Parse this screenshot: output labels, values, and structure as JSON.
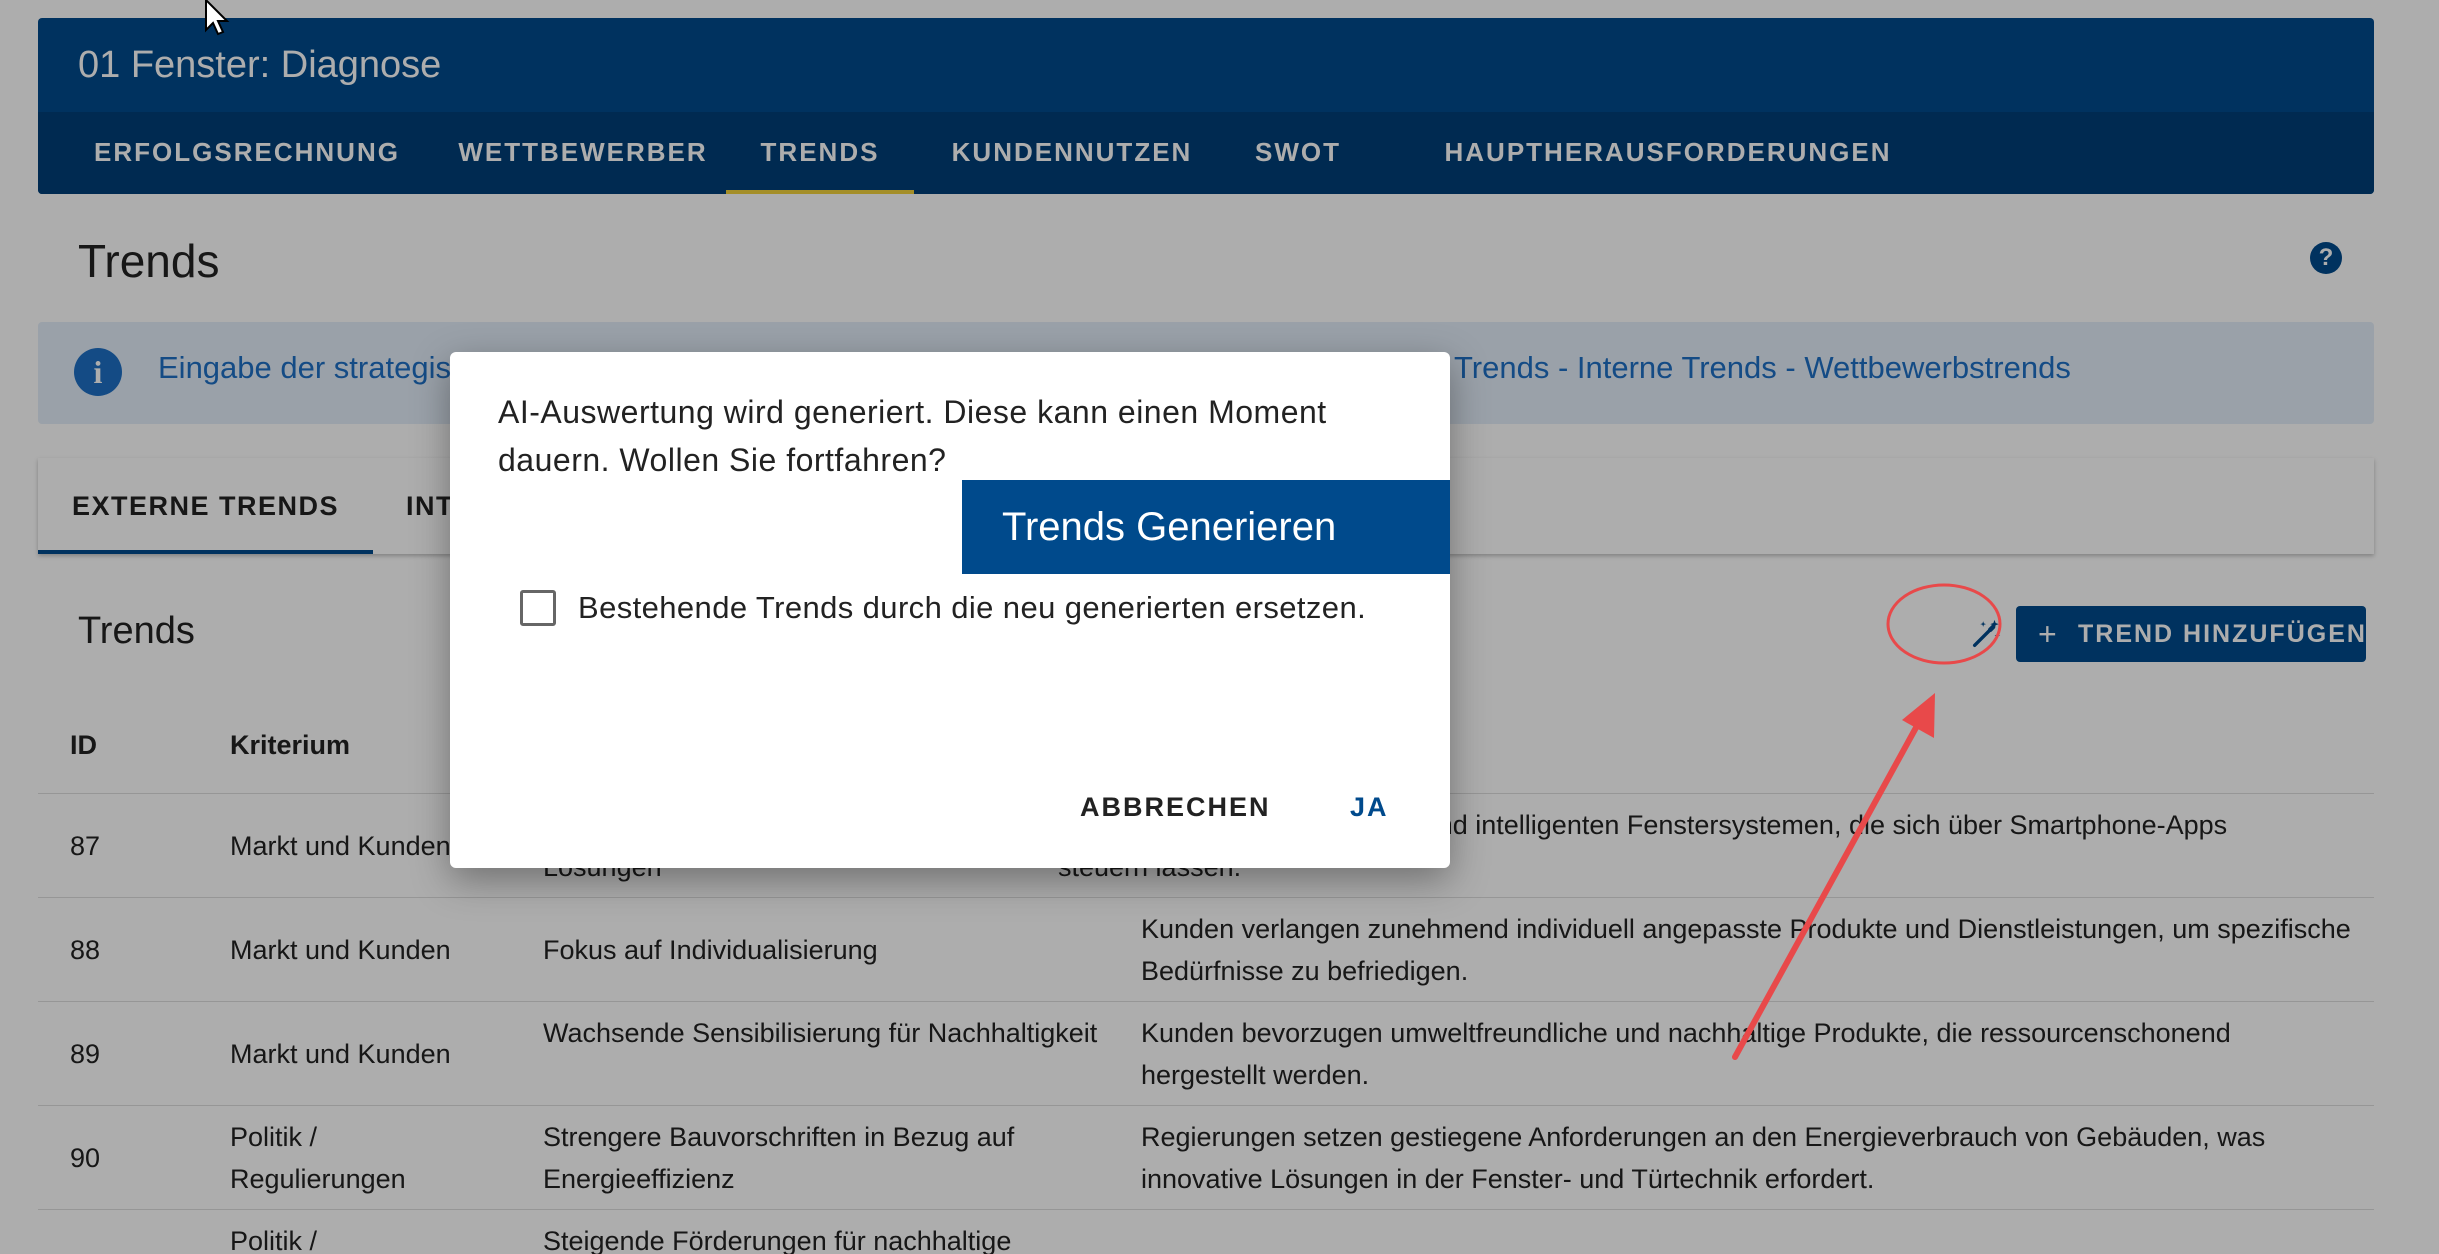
{
  "app": {
    "title": "01 Fenster: Diagnose",
    "nav_tabs": [
      {
        "label": "ERFOLGSRECHNUNG"
      },
      {
        "label": "WETTBEWERBER"
      },
      {
        "label": "TRENDS"
      },
      {
        "label": "KUNDENNUTZEN"
      },
      {
        "label": "SWOT"
      },
      {
        "label": "HAUPTHERAUSFORDERUNGEN"
      }
    ],
    "active_tab": "TRENDS"
  },
  "page": {
    "title": "Trends",
    "help_icon": "question-circle-icon",
    "info_banner": {
      "icon": "info-icon",
      "text_left": "Eingabe der strategis",
      "text_right": "Trends - Interne Trends - Wettbewerbstrends"
    },
    "sub_tabs": [
      {
        "label": "EXTERNE TRENDS"
      },
      {
        "label": "INT"
      }
    ],
    "section": {
      "title": "Trends",
      "wand_icon": "magic-wand-icon",
      "add_button": {
        "icon": "plus-icon",
        "label": "TREND HINZUFÜGEN"
      }
    },
    "table": {
      "headers": {
        "id": "ID",
        "kriterium": "Kriterium"
      },
      "rows": [
        {
          "id": "87",
          "kriterium": "Markt und Kunden",
          "trend": "Lösungen",
          "beschreibung": "mend Interesse an vernetzten und intelligenten Fenstersystemen, die sich über Smartphone-Apps steuern lassen."
        },
        {
          "id": "88",
          "kriterium": "Markt und Kunden",
          "trend": "Fokus auf Individualisierung",
          "beschreibung": "Kunden verlangen zunehmend individuell angepasste Produkte und Dienstleistungen, um spezifische Bedürfnisse zu befriedigen."
        },
        {
          "id": "89",
          "kriterium": "Markt und Kunden",
          "trend": "Wachsende Sensibilisierung für Nachhaltigkeit",
          "beschreibung": "Kunden bevorzugen umweltfreundliche und nachhaltige Produkte, die ressourcenschonend hergestellt werden."
        },
        {
          "id": "90",
          "kriterium": "Politik / Regulierungen",
          "trend": "Strengere Bauvorschriften in Bezug auf Energieeffizienz",
          "beschreibung": "Regierungen setzen gestiegene Anforderungen an den Energieverbrauch von Gebäuden, was innovative Lösungen in der Fenster- und Türtechnik erfordert."
        },
        {
          "id": "",
          "kriterium": "Politik /",
          "trend": "Steigende Förderungen für nachhaltige",
          "beschreibung": ""
        }
      ]
    }
  },
  "dialog": {
    "message": "AI-Auswertung wird generiert. Diese kann einen Moment dauern. Wollen Sie fortfahren?",
    "banner": "Trends Generieren",
    "checkbox_label": "Bestehende Trends durch die neu generierten ersetzen.",
    "checkbox_checked": false,
    "cancel_label": "ABBRECHEN",
    "confirm_label": "JA"
  },
  "colors": {
    "primary": "#004a8c",
    "nav_indicator": "#f2d23b",
    "info_text": "#1e6fc4",
    "annotation": "#e8494a"
  }
}
